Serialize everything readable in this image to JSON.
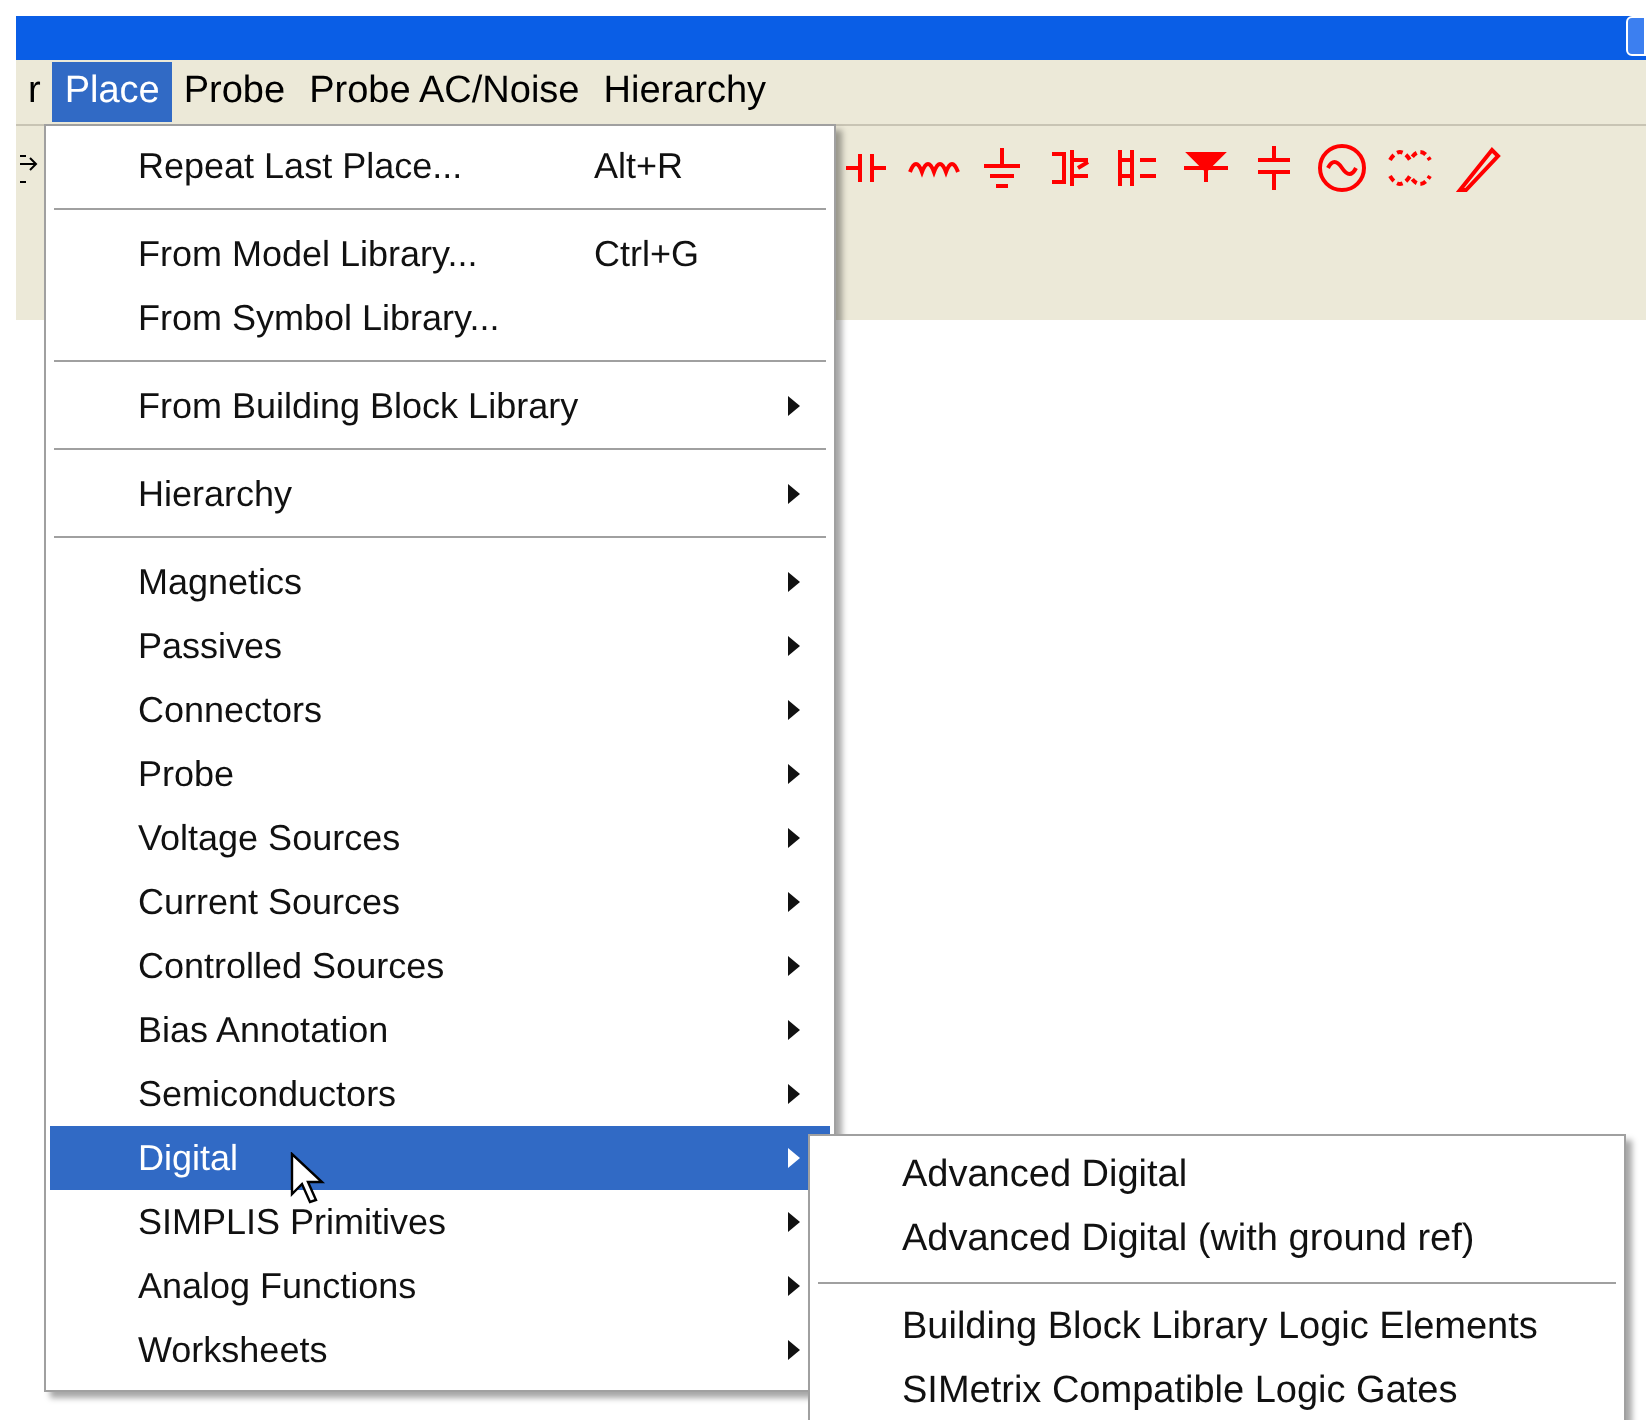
{
  "menu_bar": [
    {
      "label": "r",
      "selected": false
    },
    {
      "label": "Place",
      "selected": true
    },
    {
      "label": "Probe",
      "selected": false
    },
    {
      "label": "Probe AC/Noise",
      "selected": false
    },
    {
      "label": "Hierarchy",
      "selected": false
    }
  ],
  "place_menu": [
    {
      "kind": "item",
      "label": "Repeat Last Place...",
      "shortcut": "Alt+R",
      "submenu": false,
      "selected": false
    },
    {
      "kind": "separator"
    },
    {
      "kind": "item",
      "label": "From Model Library...",
      "shortcut": "Ctrl+G",
      "submenu": false,
      "selected": false
    },
    {
      "kind": "item",
      "label": "From Symbol Library...",
      "submenu": false,
      "selected": false
    },
    {
      "kind": "separator"
    },
    {
      "kind": "item",
      "label": "From Building Block Library",
      "submenu": true,
      "selected": false
    },
    {
      "kind": "separator"
    },
    {
      "kind": "item",
      "label": "Hierarchy",
      "submenu": true,
      "selected": false
    },
    {
      "kind": "separator"
    },
    {
      "kind": "item",
      "label": "Magnetics",
      "submenu": true,
      "selected": false
    },
    {
      "kind": "item",
      "label": "Passives",
      "submenu": true,
      "selected": false
    },
    {
      "kind": "item",
      "label": "Connectors",
      "submenu": true,
      "selected": false
    },
    {
      "kind": "item",
      "label": "Probe",
      "submenu": true,
      "selected": false
    },
    {
      "kind": "item",
      "label": "Voltage Sources",
      "submenu": true,
      "selected": false
    },
    {
      "kind": "item",
      "label": "Current Sources",
      "submenu": true,
      "selected": false
    },
    {
      "kind": "item",
      "label": "Controlled Sources",
      "submenu": true,
      "selected": false
    },
    {
      "kind": "item",
      "label": "Bias Annotation",
      "submenu": true,
      "selected": false
    },
    {
      "kind": "item",
      "label": "Semiconductors",
      "submenu": true,
      "selected": false
    },
    {
      "kind": "item",
      "label": "Digital",
      "submenu": true,
      "selected": true
    },
    {
      "kind": "item",
      "label": "SIMPLIS Primitives",
      "submenu": true,
      "selected": false
    },
    {
      "kind": "item",
      "label": "Analog Functions",
      "submenu": true,
      "selected": false
    },
    {
      "kind": "item",
      "label": "Worksheets",
      "submenu": true,
      "selected": false
    }
  ],
  "digital_submenu": [
    {
      "kind": "item",
      "label": "Advanced Digital"
    },
    {
      "kind": "item",
      "label": "Advanced Digital (with ground ref)"
    },
    {
      "kind": "separator"
    },
    {
      "kind": "item",
      "label": "Building Block Library Logic Elements"
    },
    {
      "kind": "item",
      "label": "SIMetrix Compatible Logic Gates"
    }
  ]
}
